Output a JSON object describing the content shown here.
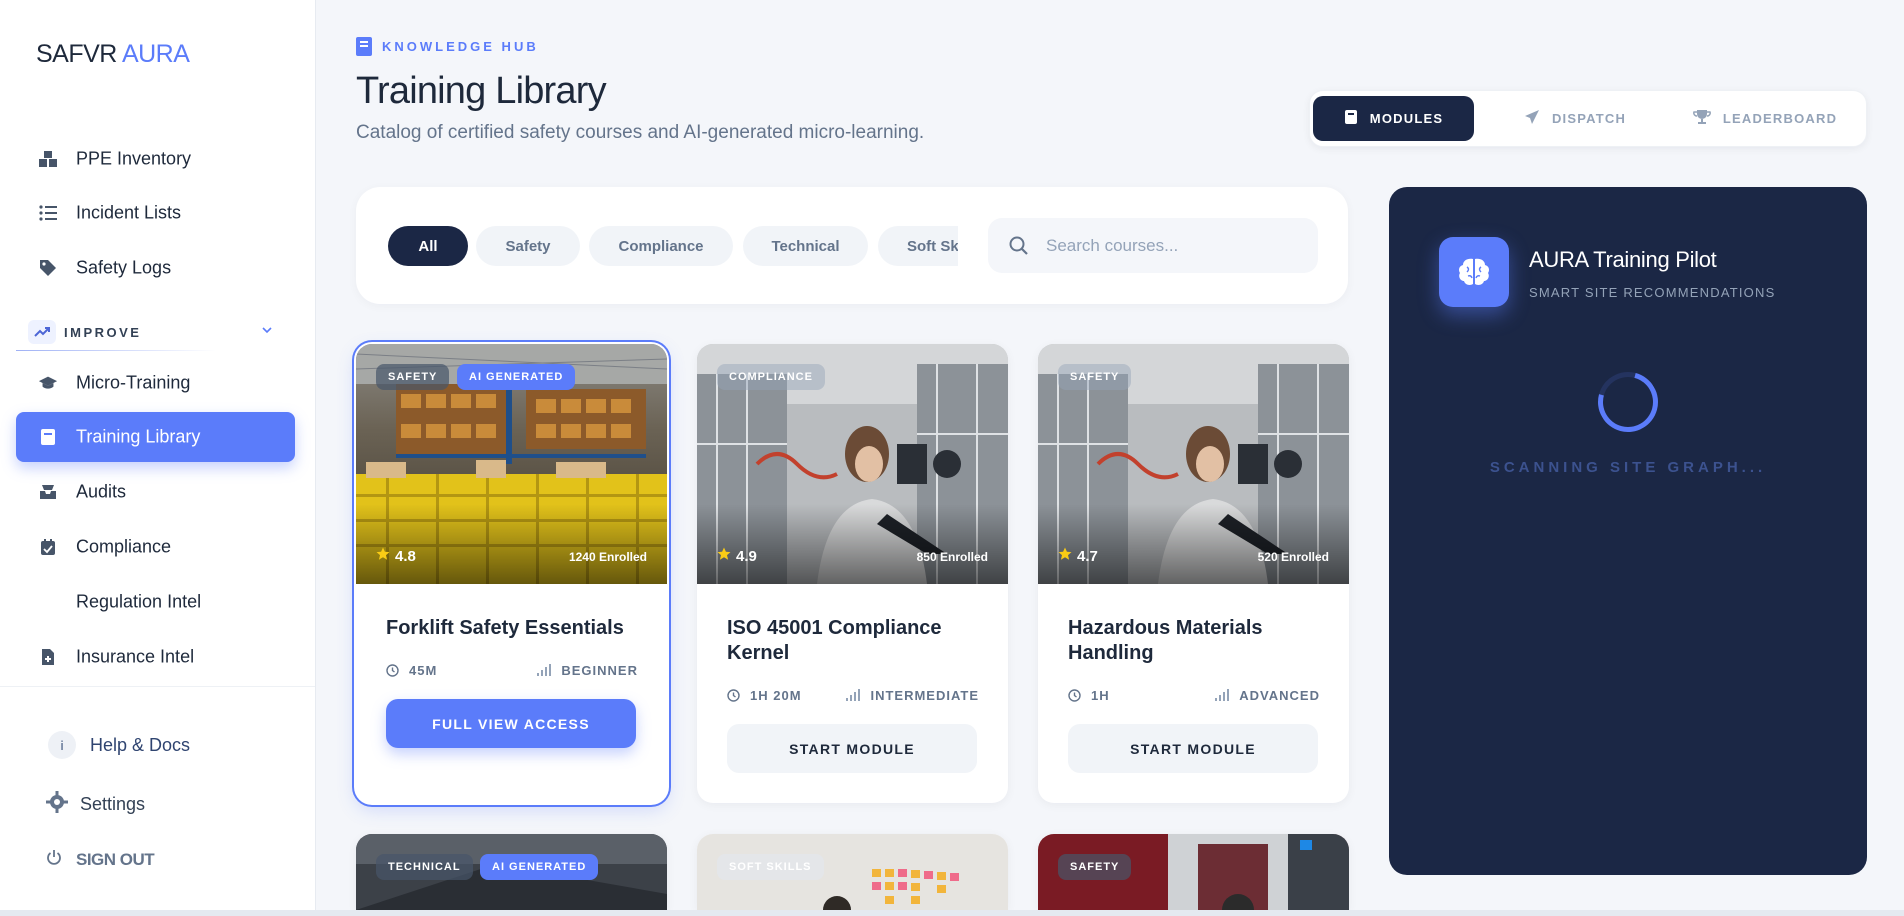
{
  "brand": {
    "part1": "SAFVR",
    "part2": "AURA"
  },
  "sidebar": {
    "items": [
      {
        "label": "PPE Inventory",
        "icon": "boxes-icon"
      },
      {
        "label": "Incident Lists",
        "icon": "list-icon"
      },
      {
        "label": "Safety Logs",
        "icon": "tag-icon"
      },
      {
        "label": "Micro-Training",
        "icon": "graduation-cap-icon"
      },
      {
        "label": "Training Library",
        "icon": "book-icon",
        "active": true
      },
      {
        "label": "Audits",
        "icon": "inbox-icon"
      },
      {
        "label": "Compliance",
        "icon": "calendar-check-icon"
      },
      {
        "label": "Regulation Intel",
        "icon": ""
      },
      {
        "label": "Insurance Intel",
        "icon": "file-medical-icon"
      }
    ],
    "section": {
      "label": "IMPROVE",
      "icon": "trend-up-icon"
    },
    "footer": {
      "help": "Help & Docs",
      "settings": "Settings",
      "signout": "SIGN OUT"
    }
  },
  "header": {
    "eyebrow": "KNOWLEDGE HUB",
    "title": "Training Library",
    "subtitle": "Catalog of certified safety courses and AI-generated micro-learning."
  },
  "tabs": [
    {
      "label": "MODULES",
      "icon": "book-icon",
      "active": true
    },
    {
      "label": "DISPATCH",
      "icon": "paper-plane-icon"
    },
    {
      "label": "LEADERBOARD",
      "icon": "trophy-icon"
    }
  ],
  "filters": {
    "chips": [
      "All",
      "Safety",
      "Compliance",
      "Technical",
      "Soft Sk"
    ],
    "active": "All",
    "search_placeholder": "Search courses...",
    "search_value": ""
  },
  "courses": [
    {
      "tags": [
        "SAFETY",
        "AI GENERATED"
      ],
      "rating": "4.8",
      "enrolled": "1240 Enrolled",
      "title": "Forklift Safety Essentials",
      "duration": "45M",
      "level": "BEGINNER",
      "action": "FULL VIEW ACCESS",
      "selected": true
    },
    {
      "tags": [
        "COMPLIANCE"
      ],
      "rating": "4.9",
      "enrolled": "850 Enrolled",
      "title": "ISO 45001 Compliance Kernel",
      "duration": "1H 20M",
      "level": "INTERMEDIATE",
      "action": "START MODULE"
    },
    {
      "tags": [
        "SAFETY"
      ],
      "rating": "4.7",
      "enrolled": "520 Enrolled",
      "title": "Hazardous Materials Handling",
      "duration": "1H",
      "level": "ADVANCED",
      "action": "START MODULE"
    },
    {
      "tags": [
        "TECHNICAL",
        "AI GENERATED"
      ]
    },
    {
      "tags": [
        "SOFT SKILLS"
      ]
    },
    {
      "tags": [
        "SAFETY"
      ]
    }
  ],
  "pilot": {
    "title": "AURA Training Pilot",
    "subtitle": "SMART SITE RECOMMENDATIONS",
    "status": "SCANNING SITE GRAPH..."
  },
  "colors": {
    "accent": "#5b7cfa",
    "navy": "#1b2745",
    "background": "#f4f6fa",
    "star": "#facc15"
  }
}
